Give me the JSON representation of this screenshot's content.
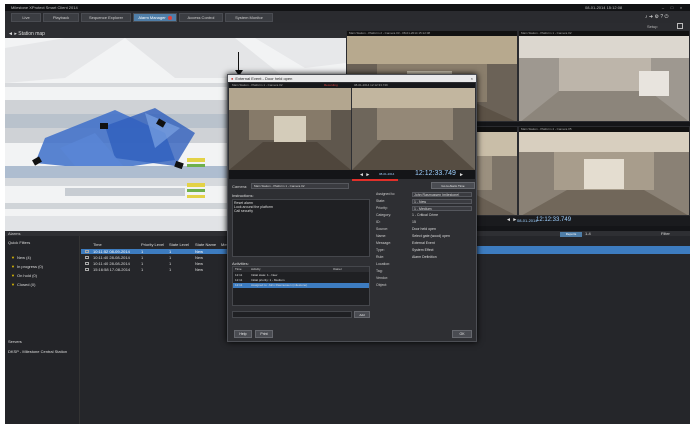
{
  "app": {
    "title": "Milestone XProtect Smart Client 2014",
    "clock": "08-01-2014 15:12:08",
    "window_buttons": [
      "–",
      "□",
      "×"
    ]
  },
  "tabs": [
    {
      "label": "Live",
      "active": false
    },
    {
      "label": "Playback",
      "active": false
    },
    {
      "label": "Sequence Explorer",
      "active": false
    },
    {
      "label": "Alarm Manager",
      "active": true
    },
    {
      "label": "Access Control",
      "active": false
    },
    {
      "label": "System Monitor",
      "active": false
    }
  ],
  "toolbar_icons": [
    "bell-icon",
    "arrow-icon",
    "gear-icon",
    "help-icon",
    "power-icon"
  ],
  "subbar": {
    "setup": "Setup"
  },
  "map": {
    "title": "Station map"
  },
  "cameras": [
    {
      "label": "Main Station - Platform 2 - Camera 03 - 08-01-2014 15:12:08"
    },
    {
      "label": "Main Station - Platform 1 - Camera 02"
    },
    {
      "label": "Main Station - Platform 3 - Camera 04"
    },
    {
      "label": "Main Station - Platform 4 - Camera 05"
    }
  ],
  "playback": {
    "date": "08-01-2014",
    "time": "12:12:33.749",
    "controls": "◄ ►"
  },
  "alarm_list": {
    "title": "Alarms",
    "reports_button": "Reports",
    "page_nav": "1-4",
    "filter_label": "Filter",
    "quick_filters_title": "Quick Filters",
    "quick_filters": [
      {
        "label": "New (4)"
      },
      {
        "label": "In progress (0)"
      },
      {
        "label": "On hold (0)"
      },
      {
        "label": "Closed (0)"
      }
    ],
    "servers_title": "Servers",
    "server_item": "DKSP - Milestone Central Station",
    "columns": [
      "Time",
      "Priority Level",
      "State Level",
      "State Name",
      "Message"
    ],
    "rows": [
      {
        "time": "10:11:52 08-09-2014",
        "priority": "1",
        "state_level": "1",
        "state_name": "New",
        "selected": true
      },
      {
        "time": "10:11:40 28-08-2014",
        "priority": "1",
        "state_level": "1",
        "state_name": "New",
        "selected": false
      },
      {
        "time": "10:11:40 28-08-2014",
        "priority": "1",
        "state_level": "1",
        "state_name": "New",
        "selected": false
      },
      {
        "time": "15:16:58 17-08-2014",
        "priority": "1",
        "state_level": "1",
        "state_name": "New",
        "selected": false
      }
    ]
  },
  "dialog": {
    "title": "External Event - Door held open",
    "cam_strip": "Main Station - Platform 1 - Camera 02",
    "cam_strip_alert": "Recording",
    "cam_strip_right": "08-01-2014 12:12:33.749",
    "playback_controls": "◄ ►",
    "playback_date": "08-01-2014",
    "playback_time": "12:12:33.749",
    "camera_label": "Camera:",
    "camera_value": "Main Station - Platform 1 - Camera 02",
    "goto_button": "Go to Alarm Time",
    "instructions_title": "Instructions:",
    "instructions": [
      "Reset alarm",
      "Look around the platform",
      "Call security"
    ],
    "activities_title": "Activities:",
    "activities_cols": [
      "Time",
      "Activity",
      "Owner"
    ],
    "activities": [
      {
        "time": "12:11",
        "activity": "Initial state: 1 - New",
        "owner": "",
        "selected": false
      },
      {
        "time": "12:11",
        "activity": "Initial priority: 1 - Medium",
        "owner": "",
        "selected": false
      },
      {
        "time": "12:11",
        "activity": "Assigned to: John Rasmussen (milestone)",
        "owner": "",
        "selected": true
      }
    ],
    "add_button": "Add",
    "print_button": "Print",
    "help_button": "Help",
    "ok_button": "OK",
    "properties": [
      {
        "label": "Assigned to:",
        "value": "John Rasmussen (milestone)",
        "dropdown": true
      },
      {
        "label": "State:",
        "value": "1 - New",
        "dropdown": true
      },
      {
        "label": "Priority:",
        "value": "1 - Medium",
        "dropdown": true
      },
      {
        "label": "Category:",
        "value": "1 - Critical Crime",
        "dropdown": false
      },
      {
        "label": "ID:",
        "value": "15",
        "dropdown": false
      },
      {
        "label": "Source:",
        "value": "Door held open",
        "dropdown": false
      },
      {
        "label": "Name:",
        "value": "Select gate (wood) open",
        "dropdown": false
      },
      {
        "label": "Message:",
        "value": "External Event",
        "dropdown": false
      },
      {
        "label": "Type:",
        "value": "System Effect",
        "dropdown": false
      },
      {
        "label": "Rule:",
        "value": "Alarm Definition",
        "dropdown": false
      },
      {
        "label": "Location:",
        "value": "",
        "dropdown": false
      },
      {
        "label": "Tag:",
        "value": "",
        "dropdown": false
      },
      {
        "label": "Vendor:",
        "value": "",
        "dropdown": false
      },
      {
        "label": "Object:",
        "value": "",
        "dropdown": false
      }
    ]
  },
  "colors": {
    "accent": "#4f7ea8",
    "selection": "#3d7cc0",
    "alert": "#e0302a",
    "filter": "#e6c200"
  }
}
